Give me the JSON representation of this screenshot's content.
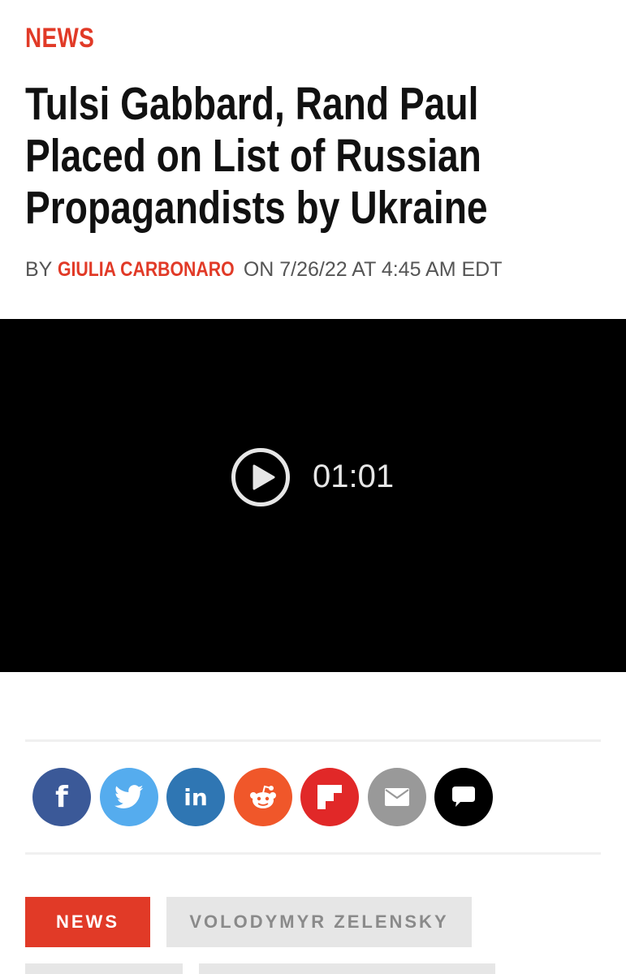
{
  "article": {
    "section": "NEWS",
    "headline_lines": [
      "Tulsi Gabbard, Rand Paul",
      "Placed on List of Russian",
      "Propagandists by Ukraine"
    ],
    "byline_prefix": "BY",
    "author": "GIULIA CARBONARO",
    "byline_date": "ON 7/26/22 AT 4:45 AM EDT"
  },
  "video": {
    "duration": "01:01"
  },
  "share": {
    "icons": [
      "facebook-icon",
      "twitter-icon",
      "linkedin-icon",
      "reddit-icon",
      "flipboard-icon",
      "email-icon",
      "comment-icon"
    ],
    "facebook_glyph": "f",
    "linkedin_glyph": "in",
    "colors": {
      "facebook": "#3b5998",
      "twitter": "#55acee",
      "linkedin": "#2f76b3",
      "reddit": "#f0572a",
      "flipboard": "#e12828",
      "email": "#999999",
      "comment": "#000000"
    }
  },
  "tags": [
    "NEWS",
    "VOLODYMYR ZELENSKY"
  ],
  "colors": {
    "accent": "#e13a27",
    "video_bg": "#000000",
    "tag_gray": "#e6e6e6"
  }
}
